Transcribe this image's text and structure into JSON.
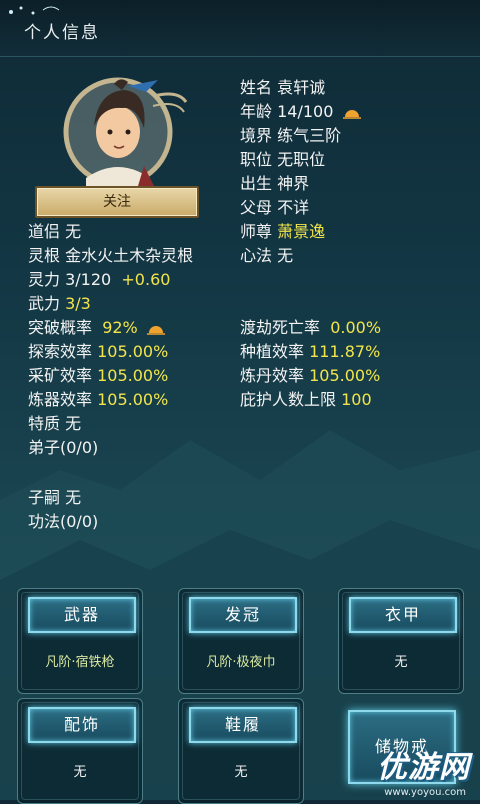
{
  "header": {
    "title": "个人信息"
  },
  "profile": {
    "name_label": "姓名",
    "name": "袁轩诚",
    "age_label": "年龄",
    "age": "14/100",
    "realm_label": "境界",
    "realm": "练气三阶",
    "position_label": "职位",
    "position": "无职位",
    "birth_label": "出生",
    "birth": "神界",
    "parents_label": "父母",
    "parents": "不详",
    "master_label": "师尊",
    "master": "萧景逸",
    "method_label": "心法",
    "method": "无",
    "follow_label": "关注"
  },
  "stats": {
    "partner_label": "道侣",
    "partner": "无",
    "root_label": "灵根",
    "root": "金水火土木杂灵根",
    "spirit_label": "灵力",
    "spirit": "3/120",
    "spirit_gain": "+0.60",
    "force_label": "武力",
    "force": "3/3",
    "breakthrough_label": "突破概率",
    "breakthrough": "92%",
    "tribulation_label": "渡劫死亡率",
    "tribulation": "0.00%",
    "explore_label": "探索效率",
    "explore": "105.00%",
    "plant_label": "种植效率",
    "plant": "111.87%",
    "mine_label": "采矿效率",
    "mine": "105.00%",
    "alchemy_label": "炼丹效率",
    "alchemy": "105.00%",
    "forge_label": "炼器效率",
    "forge": "105.00%",
    "shelter_label": "庇护人数上限",
    "shelter": "100",
    "trait_label": "特质",
    "trait": "无",
    "disciples": "弟子(0/0)",
    "heir_label": "子嗣",
    "heir": "无",
    "skills": "功法(0/0)"
  },
  "equipment": {
    "weapon_label": "武器",
    "weapon": "凡阶·宿铁枪",
    "crown_label": "发冠",
    "crown": "凡阶·极夜巾",
    "armor_label": "衣甲",
    "armor": "无",
    "accessory_label": "配饰",
    "accessory": "无",
    "shoes_label": "鞋履",
    "shoes": "无",
    "storage_label": "储物戒"
  },
  "watermark": {
    "text": "优游网",
    "sub": "www.yoyou.com"
  },
  "colors": {
    "highlight": "#f2e54b",
    "accent": "#8fd9ec",
    "gold": "#c9aa68"
  }
}
